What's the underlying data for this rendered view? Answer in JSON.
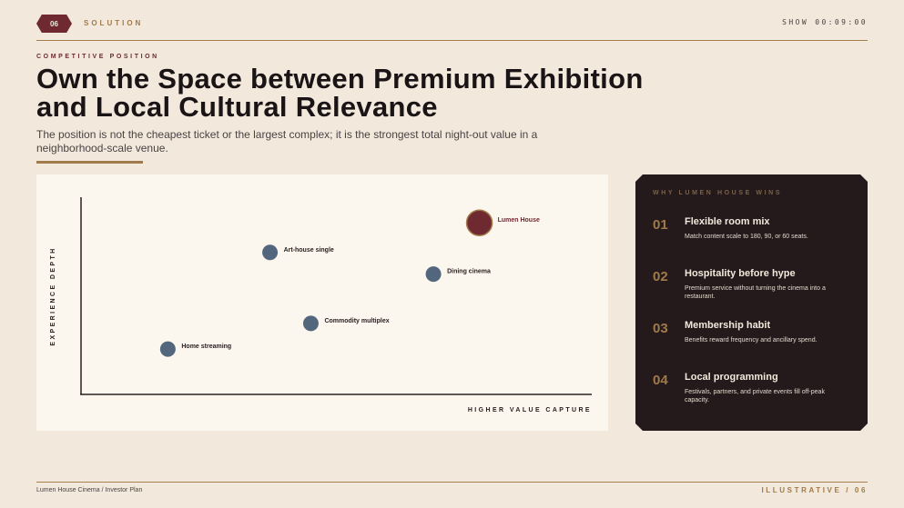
{
  "header": {
    "badge": "06",
    "section": "SOLUTION",
    "timer": "SHOW 00:09:00"
  },
  "kicker": "COMPETITIVE POSITION",
  "title": "Own the Space between Premium Exhibition and Local Cultural Relevance",
  "subtitle": "The position is not the cheapest ticket or the largest complex; it is the strongest total night-out value in a neighborhood-scale venue.",
  "colors": {
    "accent": "#6e2a30",
    "gold": "#a07a4a",
    "point": "#52677d",
    "dark": "#241a1c",
    "background": "#f2e9dc"
  },
  "chart_data": {
    "type": "scatter",
    "xlabel": "HIGHER VALUE CAPTURE",
    "ylabel": "EXPERIENCE DEPTH",
    "xlim": [
      0,
      100
    ],
    "ylim": [
      0,
      100
    ],
    "grid": false,
    "points": [
      {
        "label": "Home streaming",
        "x": 17,
        "y": 23,
        "highlight": false
      },
      {
        "label": "Commodity multiplex",
        "x": 45,
        "y": 36,
        "highlight": false
      },
      {
        "label": "Art-house single",
        "x": 37,
        "y": 72,
        "highlight": false
      },
      {
        "label": "Dining cinema",
        "x": 69,
        "y": 61,
        "highlight": false
      },
      {
        "label": "Lumen House",
        "x": 78,
        "y": 87,
        "highlight": true
      }
    ]
  },
  "panel": {
    "title": "WHY LUMEN HOUSE WINS",
    "items": [
      {
        "num": "01",
        "head": "Flexible room mix",
        "desc": "Match content scale to 180, 90, or 60 seats."
      },
      {
        "num": "02",
        "head": "Hospitality before hype",
        "desc": "Premium service without turning the cinema into a restaurant."
      },
      {
        "num": "03",
        "head": "Membership habit",
        "desc": "Benefits reward frequency and ancillary spend."
      },
      {
        "num": "04",
        "head": "Local programming",
        "desc": "Festivals, partners, and private events fill off-peak capacity."
      }
    ]
  },
  "footer": {
    "left": "Lumen House Cinema / Investor Plan",
    "right": "ILLUSTRATIVE / 06"
  }
}
